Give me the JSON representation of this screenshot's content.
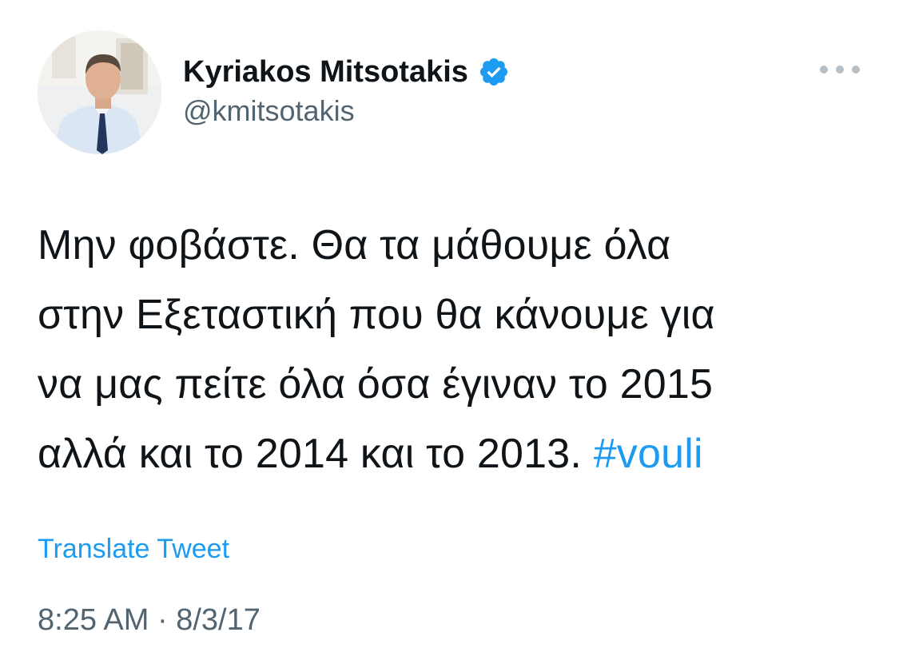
{
  "author": {
    "display_name": "Kyriakos Mitsotakis",
    "handle": "@kmitsotakis",
    "verified": true,
    "verified_icon": "verified-badge-icon",
    "avatar": "profile-photo"
  },
  "tweet": {
    "text_lines": [
      "Μην φοβάστε. Θα τα μάθουμε όλα",
      "στην Εξεταστική που θα κάνουμε για",
      "να μας πείτε όλα όσα έγιναν το 2015",
      "αλλά και το 2014 και το 2013. "
    ],
    "hashtag": "#vouli",
    "translate_label": "Translate Tweet",
    "time": "8:25 AM",
    "separator": " · ",
    "date": "8/3/17"
  },
  "menu": {
    "icon": "more-options-icon"
  },
  "colors": {
    "link": "#1d9bf0",
    "secondary_text": "#536471",
    "primary_text": "#0f1419"
  }
}
